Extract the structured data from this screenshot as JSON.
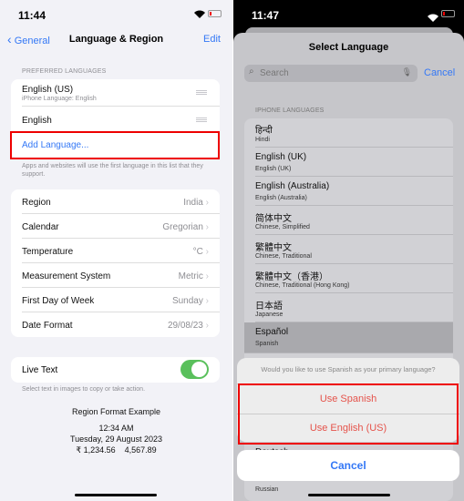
{
  "left": {
    "status_time": "11:44",
    "nav": {
      "back": "General",
      "title": "Language & Region",
      "edit": "Edit"
    },
    "preferred_header": "PREFERRED LANGUAGES",
    "languages": [
      {
        "name": "English (US)",
        "sub": "iPhone Language: English"
      },
      {
        "name": "English",
        "sub": ""
      }
    ],
    "add_language": "Add Language...",
    "languages_footnote": "Apps and websites will use the first language in this list that they support.",
    "settings": [
      {
        "label": "Region",
        "value": "India"
      },
      {
        "label": "Calendar",
        "value": "Gregorian"
      },
      {
        "label": "Temperature",
        "value": "°C"
      },
      {
        "label": "Measurement System",
        "value": "Metric"
      },
      {
        "label": "First Day of Week",
        "value": "Sunday"
      },
      {
        "label": "Date Format",
        "value": "29/08/23"
      }
    ],
    "live_text": {
      "label": "Live Text",
      "on": true,
      "footnote": "Select text in images to copy or take action."
    },
    "example": {
      "title": "Region Format Example",
      "time": "12:34 AM",
      "date": "Tuesday, 29 August 2023",
      "numbers": "₹ 1,234.56    4,567.89"
    }
  },
  "right": {
    "status_time": "11:47",
    "title": "Select Language",
    "search_placeholder": "Search",
    "cancel": "Cancel",
    "section": "IPHONE LANGUAGES",
    "languages": [
      {
        "name": "हिन्दी",
        "sub": "Hindi"
      },
      {
        "name": "English (UK)",
        "sub": "English (UK)"
      },
      {
        "name": "English (Australia)",
        "sub": "English (Australia)"
      },
      {
        "name": "简体中文",
        "sub": "Chinese, Simplified"
      },
      {
        "name": "繁體中文",
        "sub": "Chinese, Traditional"
      },
      {
        "name": "繁體中文（香港）",
        "sub": "Chinese, Traditional (Hong Kong)"
      },
      {
        "name": "日本語",
        "sub": "Japanese"
      },
      {
        "name": "Español",
        "sub": "Spanish"
      }
    ],
    "behind": {
      "deutsch": "Deutsch",
      "russian": "Russian"
    },
    "action_sheet": {
      "question": "Would you like to use Spanish as your primary language?",
      "use_spanish": "Use Spanish",
      "use_english": "Use English (US)",
      "cancel": "Cancel"
    }
  },
  "colors": {
    "accent": "#3478f6",
    "destructive": "#e5534b",
    "toggle_on": "#5ac05c",
    "highlight": "#e00000"
  }
}
